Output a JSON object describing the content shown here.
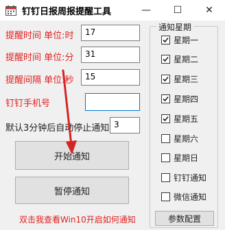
{
  "window": {
    "title": "钉钉日报周报提醒工具",
    "minimize_symbol": "—",
    "maximize_symbol": "☐",
    "close_symbol": "✕"
  },
  "form": {
    "remind_time_hour_label": "提醒时间 单位:时",
    "remind_time_hour_value": "17",
    "remind_time_minute_label": "提醒时间 单位:分",
    "remind_time_minute_value": "31",
    "remind_interval_label": "提醒间隔 单位:秒",
    "remind_interval_value": "15",
    "phone_label": "钉钉手机号",
    "phone_value": "",
    "auto_stop_label": "默认3分钟后自动停止通知",
    "auto_stop_value": "3"
  },
  "buttons": {
    "start_label": "开始通知",
    "pause_label": "暂停通知",
    "settings_label": "参数配置"
  },
  "notify_days": {
    "group_title": "通知星期",
    "items": [
      {
        "label": "星期一",
        "checked": true
      },
      {
        "label": "星期二",
        "checked": true
      },
      {
        "label": "星期三",
        "checked": true
      },
      {
        "label": "星期四",
        "checked": true
      },
      {
        "label": "星期五",
        "checked": true
      },
      {
        "label": "星期六",
        "checked": false
      },
      {
        "label": "星期日",
        "checked": false
      },
      {
        "label": "钉钉通知",
        "checked": false
      },
      {
        "label": "微信通知",
        "checked": false
      }
    ]
  },
  "footer": {
    "help_link": "双击我查看Win10开启如何通知"
  },
  "colors": {
    "accent_red": "#e02020",
    "annotation_arrow": "#d42424",
    "focus_border": "#0078d7"
  },
  "icons": {
    "app": "calendar-icon",
    "annotation": "red-arrow-annotation"
  }
}
